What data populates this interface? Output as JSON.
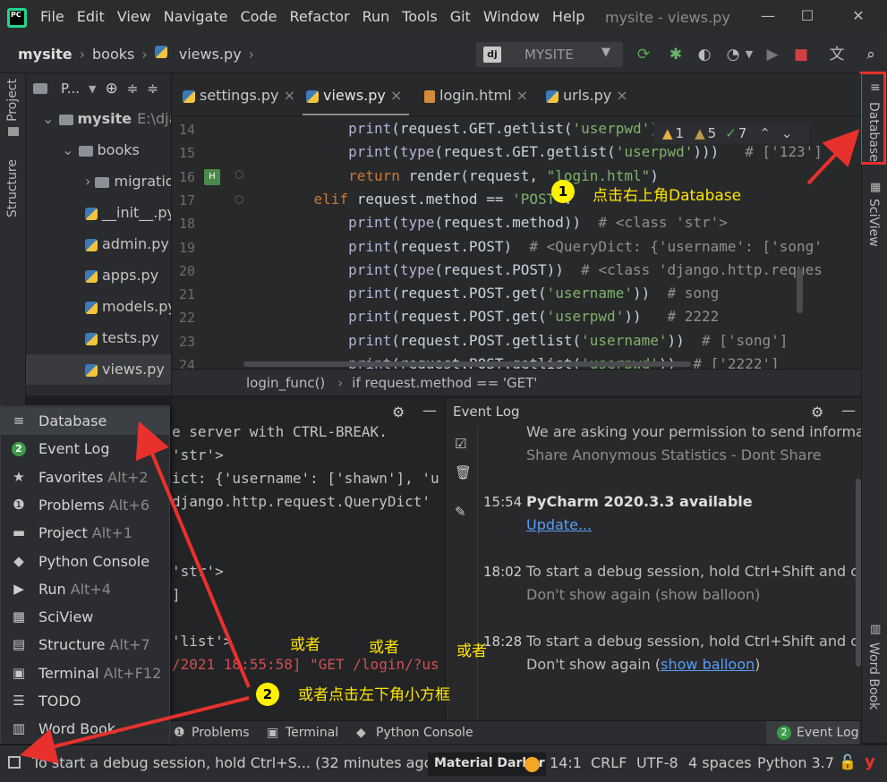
{
  "app": {
    "logo_text": "PC",
    "window_title": "mysite - views.py",
    "menu": [
      "File",
      "Edit",
      "View",
      "Navigate",
      "Code",
      "Refactor",
      "Run",
      "Tools",
      "Git",
      "Window",
      "Help"
    ]
  },
  "nav": {
    "breadcrumb": [
      "mysite",
      "books",
      "views.py"
    ],
    "run_config": "MYSITE",
    "run_config_icon_text": "dj"
  },
  "left_strip": {
    "project": "Project",
    "structure": "Structure"
  },
  "right_strip": {
    "database": "Database",
    "sciview": "SciView",
    "wordbook": "Word Book"
  },
  "project_pane": {
    "header": "P...",
    "tree": [
      {
        "label": "mysite",
        "extra": "E:\\djang",
        "type": "folder"
      },
      {
        "label": "books",
        "type": "folder"
      },
      {
        "label": "migrations",
        "type": "folder"
      },
      {
        "label": "__init__.py",
        "type": "py"
      },
      {
        "label": "admin.py",
        "type": "py"
      },
      {
        "label": "apps.py",
        "type": "py"
      },
      {
        "label": "models.py",
        "type": "py"
      },
      {
        "label": "tests.py",
        "type": "py"
      },
      {
        "label": "views.py",
        "type": "py"
      }
    ]
  },
  "editor": {
    "tabs": [
      "settings.py",
      "views.py",
      "login.html",
      "urls.py"
    ],
    "active_tab": "views.py",
    "inspections": {
      "warn_count": "1",
      "weak_count": "5",
      "ok_count": "7"
    },
    "line_numbers": [
      "14",
      "15",
      "16",
      "17",
      "18",
      "19",
      "20",
      "21",
      "22",
      "23",
      "24"
    ],
    "lines": [
      {
        "ind": "        ",
        "parts": [
          [
            "fn",
            "print"
          ],
          [
            "",
            "(request.GET.getlist("
          ],
          [
            "str",
            "'userpwd'"
          ],
          [
            "",
            "))"
          ]
        ]
      },
      {
        "ind": "        ",
        "parts": [
          [
            "fn",
            "print"
          ],
          [
            "",
            "("
          ],
          [
            "fn",
            "type"
          ],
          [
            "",
            "(request.GET.getlist("
          ],
          [
            "str",
            "'userpwd'"
          ],
          [
            "",
            ")))   "
          ],
          [
            "cmt",
            "# ['123']"
          ]
        ]
      },
      {
        "ind": "        ",
        "parts": [
          [
            "kw",
            "return "
          ],
          [
            "",
            "render(request, "
          ],
          [
            "str",
            "\"login.html\""
          ],
          [
            "",
            ")"
          ]
        ]
      },
      {
        "ind": "    ",
        "parts": [
          [
            "kw",
            "elif "
          ],
          [
            "",
            "request.method == "
          ],
          [
            "str",
            "'POST'"
          ],
          [
            "",
            ":"
          ]
        ]
      },
      {
        "ind": "        ",
        "parts": [
          [
            "fn",
            "print"
          ],
          [
            "",
            "("
          ],
          [
            "fn",
            "type"
          ],
          [
            "",
            "(request.method))  "
          ],
          [
            "cmt",
            "# <class 'str'>"
          ]
        ]
      },
      {
        "ind": "        ",
        "parts": [
          [
            "fn",
            "print"
          ],
          [
            "",
            "(request.POST)  "
          ],
          [
            "cmt",
            "# <QueryDict: {'username': ['song'"
          ]
        ]
      },
      {
        "ind": "        ",
        "parts": [
          [
            "fn",
            "print"
          ],
          [
            "",
            "("
          ],
          [
            "fn",
            "type"
          ],
          [
            "",
            "(request.POST))  "
          ],
          [
            "cmt",
            "# <class 'django.http.reques"
          ]
        ]
      },
      {
        "ind": "        ",
        "parts": [
          [
            "fn",
            "print"
          ],
          [
            "",
            "(request.POST.get("
          ],
          [
            "str",
            "'username'"
          ],
          [
            "",
            "))  "
          ],
          [
            "cmt",
            "# song"
          ]
        ]
      },
      {
        "ind": "        ",
        "parts": [
          [
            "fn",
            "print"
          ],
          [
            "",
            "(request.POST.get("
          ],
          [
            "str",
            "'userpwd'"
          ],
          [
            "",
            "))   "
          ],
          [
            "cmt",
            "# 2222"
          ]
        ]
      },
      {
        "ind": "        ",
        "parts": [
          [
            "fn",
            "print"
          ],
          [
            "",
            "(request.POST.getlist("
          ],
          [
            "str",
            "'username'"
          ],
          [
            "",
            "))  "
          ],
          [
            "cmt",
            "# ['song']"
          ]
        ]
      },
      {
        "ind": "        ",
        "parts": [
          [
            "fn",
            "print"
          ],
          [
            "",
            "(request.POST.getlist("
          ],
          [
            "str",
            "'userpwd'"
          ],
          [
            "",
            "))  "
          ],
          [
            "cmt",
            "# ['2222']"
          ]
        ]
      }
    ],
    "breadcrumb_func": "login_func()",
    "breadcrumb_cond": "if request.method == 'GET'"
  },
  "run_console": {
    "lines": [
      "e server with CTRL-BREAK.",
      "'str'>",
      "ict: {'username': ['shawn'], 'u",
      "django.http.request.QueryDict'",
      "",
      "",
      "'str'>",
      "]",
      "",
      "'list'>",
      "/2021 18:55:58] \"GET /login/?us"
    ]
  },
  "event_log": {
    "title": "Event Log",
    "entries": [
      {
        "time": "",
        "text": "We are asking your permission to send information a"
      },
      {
        "time": "",
        "text": "Share Anonymous Statistics - Dont Share",
        "muted": true
      },
      {
        "time": "15:54",
        "text": "PyCharm 2020.3.3 available",
        "bold": true
      },
      {
        "time": "",
        "text": "Update...",
        "link": true
      },
      {
        "time": "18:02",
        "text": "To start a debug session, hold Ctrl+Shift and click th"
      },
      {
        "time": "",
        "text": "Don't show again (show balloon)",
        "muted": true
      },
      {
        "time": "18:28",
        "text": "To start a debug session, hold Ctrl+Shift and click th"
      },
      {
        "time": "",
        "text_pre": "Don't show again (",
        "text_link": "show balloon",
        "text_post": ")"
      }
    ]
  },
  "tool_menu": {
    "items": [
      {
        "label": "Database",
        "shortcut": "",
        "icon": "database-icon",
        "glyph": "≡"
      },
      {
        "label": "Event Log",
        "shortcut": "",
        "icon": "event-log-icon",
        "glyph": "2"
      },
      {
        "label": "Favorites",
        "shortcut": "Alt+2",
        "icon": "star-icon",
        "glyph": "★"
      },
      {
        "label": "Problems",
        "shortcut": "Alt+6",
        "icon": "problems-icon",
        "glyph": "❶"
      },
      {
        "label": "Project",
        "shortcut": "Alt+1",
        "icon": "folder-icon",
        "glyph": "▬"
      },
      {
        "label": "Python Console",
        "shortcut": "",
        "icon": "python-icon",
        "glyph": "◆"
      },
      {
        "label": "Run",
        "shortcut": "Alt+4",
        "icon": "run-icon",
        "glyph": "▶"
      },
      {
        "label": "SciView",
        "shortcut": "",
        "icon": "sciview-icon",
        "glyph": "▦"
      },
      {
        "label": "Structure",
        "shortcut": "Alt+7",
        "icon": "structure-icon",
        "glyph": "▤"
      },
      {
        "label": "Terminal",
        "shortcut": "Alt+F12",
        "icon": "terminal-icon",
        "glyph": "▣"
      },
      {
        "label": "TODO",
        "shortcut": "",
        "icon": "todo-icon",
        "glyph": "☰"
      },
      {
        "label": "Word Book",
        "shortcut": "",
        "icon": "wordbook-icon",
        "glyph": "▥"
      }
    ]
  },
  "bottom_bar": {
    "problems": "Problems",
    "terminal": "Terminal",
    "python_console": "Python Console",
    "event_log": "Event Log",
    "event_log_count": "2"
  },
  "status_bar": {
    "message": "To start a debug session, hold Ctrl+S... (32 minutes ago)",
    "theme": "Material Darker",
    "position": "14:1",
    "line_sep": "CRLF",
    "encoding": "UTF-8",
    "indent": "4 spaces",
    "interpreter": "Python 3.7"
  },
  "annotations": {
    "one": "1",
    "one_text": "点击右上角Database",
    "two": "2",
    "two_text": "或者点击左下角小方框",
    "or1": "或者",
    "or2": "或者",
    "or3": "或者"
  },
  "colors": {
    "annotation_yellow": "#ffe500",
    "arrow_red": "#e8312d",
    "accent_green": "#21d789"
  }
}
